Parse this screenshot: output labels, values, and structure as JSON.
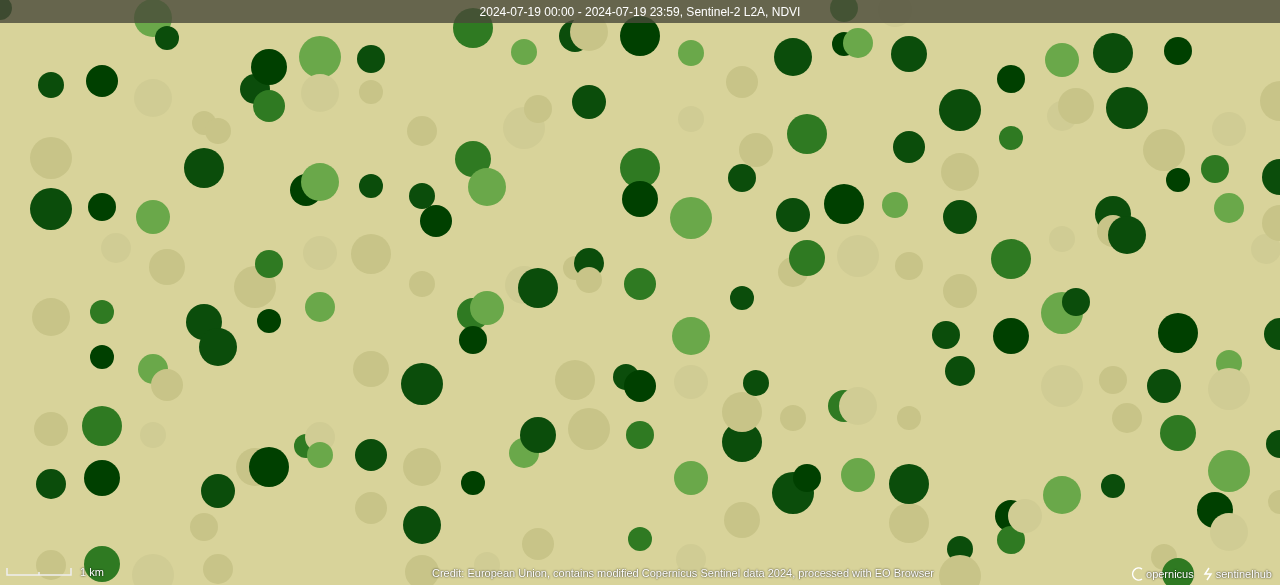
{
  "title_bar": {
    "text": "2024-07-19 00:00 - 2024-07-19 23:59, Sentinel-2 L2A, NDVI"
  },
  "scale_bar": {
    "label": "1 km"
  },
  "credit": "Credit: European Union, contains modified Copernicus Sentinel data 2024, processed with EO Browser",
  "logos": [
    {
      "kind": "copernicus",
      "text": "opernicus"
    },
    {
      "kind": "sentinelhub",
      "text": "sentinelhub"
    }
  ]
}
